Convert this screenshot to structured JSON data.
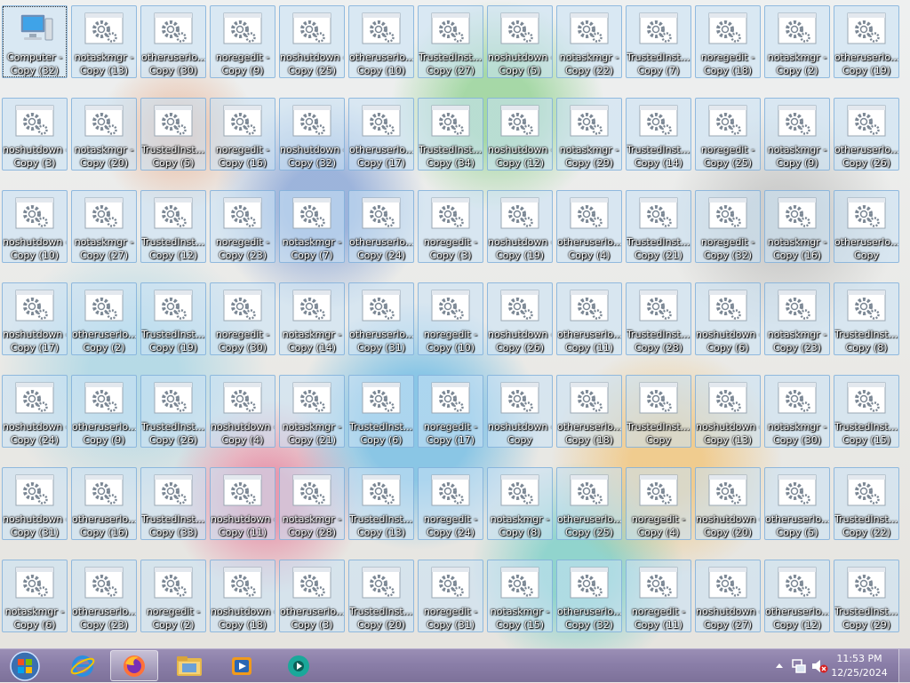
{
  "desktop": {
    "computer": {
      "label": "Computer - Copy (32)",
      "icon": "computer-icon"
    },
    "file_icon": "settings-file-icon",
    "rows": [
      [
        "notaskmgr - Copy (13)",
        "otheruserlo... - Copy (30)",
        "noregedit - Copy (9)",
        "noshutdown - Copy (25)",
        "otheruserlo... - Copy (10)",
        "TrustedInst... - Copy (27)",
        "noshutdown - Copy (5)",
        "notaskmgr - Copy (22)",
        "TrustedInst... - Copy (7)",
        "noregedit - Copy (18)",
        "notaskmgr - Copy (2)",
        "otheruserlo... - Copy (19)"
      ],
      [
        "noshutdown - Copy (3)",
        "notaskmgr - Copy (20)",
        "TrustedInst... - Copy (5)",
        "noregedit - Copy (16)",
        "noshutdown - Copy (32)",
        "otheruserlo... - Copy (17)",
        "TrustedInst... - Copy (34)",
        "noshutdown - Copy (12)",
        "notaskmgr - Copy (29)",
        "TrustedInst... - Copy (14)",
        "noregedit - Copy (25)",
        "notaskmgr - Copy (9)",
        "otheruserlo... - Copy (26)"
      ],
      [
        "noshutdown - Copy (10)",
        "notaskmgr - Copy (27)",
        "TrustedInst... - Copy (12)",
        "noregedit - Copy (23)",
        "notaskmgr - Copy (7)",
        "otheruserlo... - Copy (24)",
        "noregedit - Copy (3)",
        "noshutdown - Copy (19)",
        "otheruserlo... - Copy (4)",
        "TrustedInst... - Copy (21)",
        "noregedit - Copy (32)",
        "notaskmgr - Copy (16)",
        "otheruserlo... - Copy"
      ],
      [
        "noshutdown - Copy (17)",
        "otheruserlo... - Copy (2)",
        "TrustedInst... - Copy (19)",
        "noregedit - Copy (30)",
        "notaskmgr - Copy (14)",
        "otheruserlo... - Copy (31)",
        "noregedit - Copy (10)",
        "noshutdown - Copy (26)",
        "otheruserlo... - Copy (11)",
        "TrustedInst... - Copy (28)",
        "noshutdown - Copy (6)",
        "notaskmgr - Copy (23)",
        "TrustedInst... - Copy (8)"
      ],
      [
        "noshutdown - Copy (24)",
        "otheruserlo... - Copy (9)",
        "TrustedInst... - Copy (26)",
        "noshutdown - Copy (4)",
        "notaskmgr - Copy (21)",
        "TrustedInst... - Copy (6)",
        "noregedit - Copy (17)",
        "noshutdown - Copy",
        "otheruserlo... - Copy (18)",
        "TrustedInst... - Copy",
        "noshutdown - Copy (13)",
        "notaskmgr - Copy (30)",
        "TrustedInst... - Copy (15)"
      ],
      [
        "noshutdown - Copy (31)",
        "otheruserlo... - Copy (16)",
        "TrustedInst... - Copy (33)",
        "noshutdown - Copy (11)",
        "notaskmgr - Copy (28)",
        "TrustedInst... - Copy (13)",
        "noregedit - Copy (24)",
        "notaskmgr - Copy (8)",
        "otheruserlo... - Copy (25)",
        "noregedit - Copy (4)",
        "noshutdown - Copy (20)",
        "otheruserlo... - Copy (5)",
        "TrustedInst... - Copy (22)"
      ],
      [
        "notaskmgr - Copy (6)",
        "otheruserlo... - Copy (23)",
        "noregedit - Copy (2)",
        "noshutdown - Copy (18)",
        "otheruserlo... - Copy (3)",
        "TrustedInst... - Copy (20)",
        "noregedit - Copy (31)",
        "notaskmgr - Copy (15)",
        "otheruserlo... - Copy (32)",
        "noregedit - Copy (11)",
        "noshutdown - Copy (27)",
        "otheruserlo... - Copy (12)",
        "TrustedInst... - Copy (29)"
      ]
    ]
  },
  "taskbar": {
    "start_icon": "windows-logo-icon",
    "pinned": [
      {
        "name": "internet-explorer",
        "icon": "internet-explorer-icon",
        "active": false
      },
      {
        "name": "firefox",
        "icon": "firefox-icon",
        "active": true
      },
      {
        "name": "file-explorer",
        "icon": "folder-icon",
        "active": false
      },
      {
        "name": "media-player",
        "icon": "media-player-icon",
        "active": false
      },
      {
        "name": "app",
        "icon": "teal-circle-app-icon",
        "active": false
      }
    ],
    "tray": {
      "time": "11:53 PM",
      "date": "12/25/2024",
      "icons": [
        "chevron-up-icon",
        "network-icon",
        "volume-muted-icon"
      ]
    }
  },
  "colors": {
    "taskbar": "#8a7ea8",
    "selection": "#c8e2f6"
  }
}
